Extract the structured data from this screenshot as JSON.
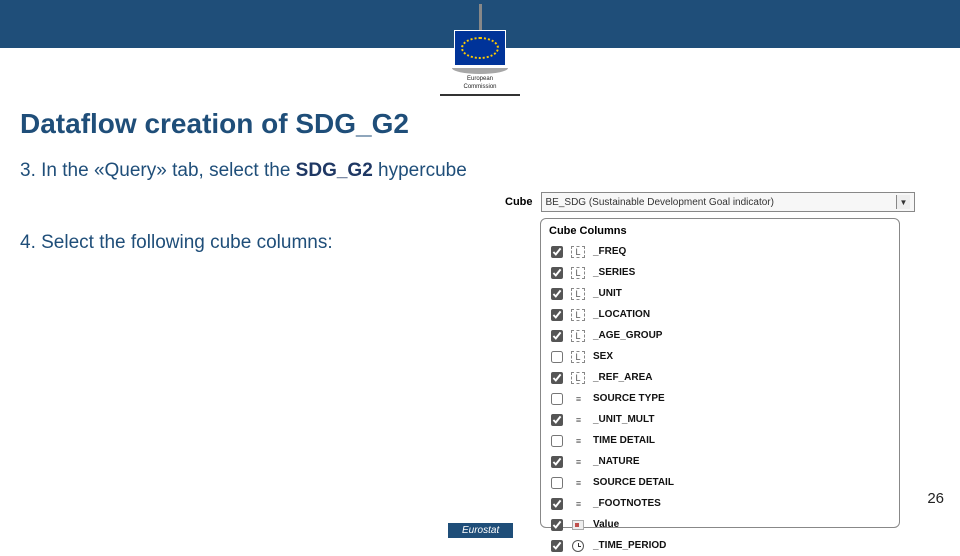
{
  "logo": {
    "line1": "European",
    "line2": "Commission"
  },
  "title": "Dataflow creation of SDG_G2",
  "step3": {
    "prefix": "3. In the «Query» tab, select the ",
    "bold": "SDG_G2",
    "suffix": " hypercube"
  },
  "step4": "4. Select the following cube columns:",
  "cube": {
    "label": "Cube",
    "value": "BE_SDG (Sustainable Development Goal indicator)"
  },
  "panel": {
    "title": "Cube Columns"
  },
  "cols": [
    {
      "checked": true,
      "icon": "L",
      "name": "_FREQ"
    },
    {
      "checked": true,
      "icon": "L",
      "name": "_SERIES"
    },
    {
      "checked": true,
      "icon": "L",
      "name": "_UNIT"
    },
    {
      "checked": true,
      "icon": "L",
      "name": "_LOCATION"
    },
    {
      "checked": true,
      "icon": "L",
      "name": "_AGE_GROUP"
    },
    {
      "checked": false,
      "icon": "L",
      "name": "SEX"
    },
    {
      "checked": true,
      "icon": "L",
      "name": "_REF_AREA"
    },
    {
      "checked": false,
      "icon": "eq",
      "name": "SOURCE TYPE"
    },
    {
      "checked": true,
      "icon": "eq",
      "name": "_UNIT_MULT"
    },
    {
      "checked": false,
      "icon": "eq",
      "name": "TIME DETAIL"
    },
    {
      "checked": true,
      "icon": "eq",
      "name": "_NATURE"
    },
    {
      "checked": false,
      "icon": "eq",
      "name": "SOURCE DETAIL"
    },
    {
      "checked": true,
      "icon": "eq",
      "name": "_FOOTNOTES"
    },
    {
      "checked": true,
      "icon": "box",
      "name": "Value"
    },
    {
      "checked": true,
      "icon": "clock",
      "name": "_TIME_PERIOD"
    }
  ],
  "pagenum": "26",
  "footer": "Eurostat"
}
